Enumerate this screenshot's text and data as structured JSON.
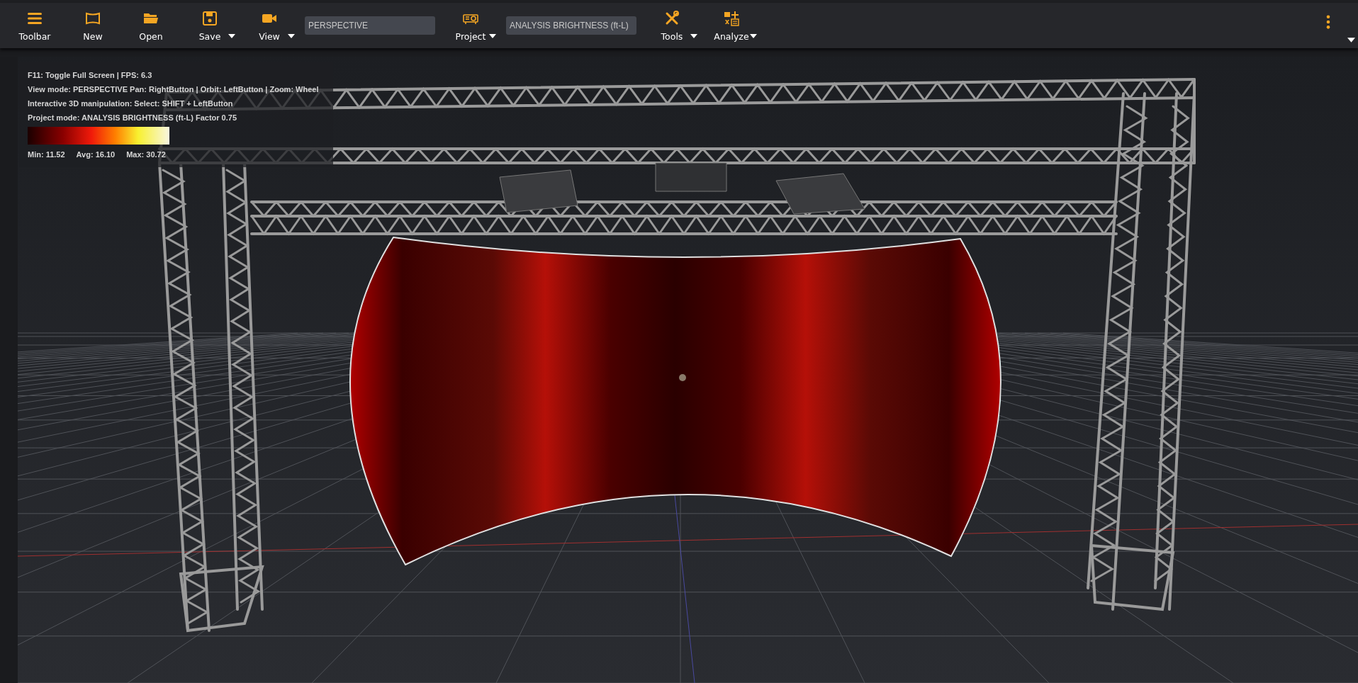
{
  "toolbar": {
    "items": [
      {
        "kind": "button",
        "label": "Toolbar",
        "has_menu": false
      },
      {
        "kind": "button",
        "label": "New",
        "has_menu": false
      },
      {
        "kind": "button",
        "label": "Open",
        "has_menu": false
      },
      {
        "kind": "button",
        "label": "Save",
        "has_menu": true
      },
      {
        "kind": "button",
        "label": "View",
        "has_menu": true
      },
      {
        "kind": "field",
        "value": "PERSPECTIVE"
      },
      {
        "kind": "button",
        "label": "Project",
        "has_menu": true
      },
      {
        "kind": "field",
        "value": "ANALYSIS BRIGHTNESS (ft-L)"
      },
      {
        "kind": "button",
        "label": "Tools",
        "has_menu": true
      },
      {
        "kind": "button",
        "label": "Analyze",
        "has_menu": true
      }
    ]
  },
  "viewport": {
    "info_lines": [
      "F11: Toggle Full Screen | FPS: 6.3",
      "View mode: PERSPECTIVE Pan: RightButton | Orbit: LeftButton | Zoom: Wheel",
      "Interactive 3D manipulation: Select: SHIFT + LeftButton",
      "Project mode: ANALYSIS BRIGHTNESS (ft-L) Factor 0.75"
    ],
    "stats": [
      "Min: 11.52",
      "Avg: 16.10",
      "Max: 30.72"
    ]
  }
}
